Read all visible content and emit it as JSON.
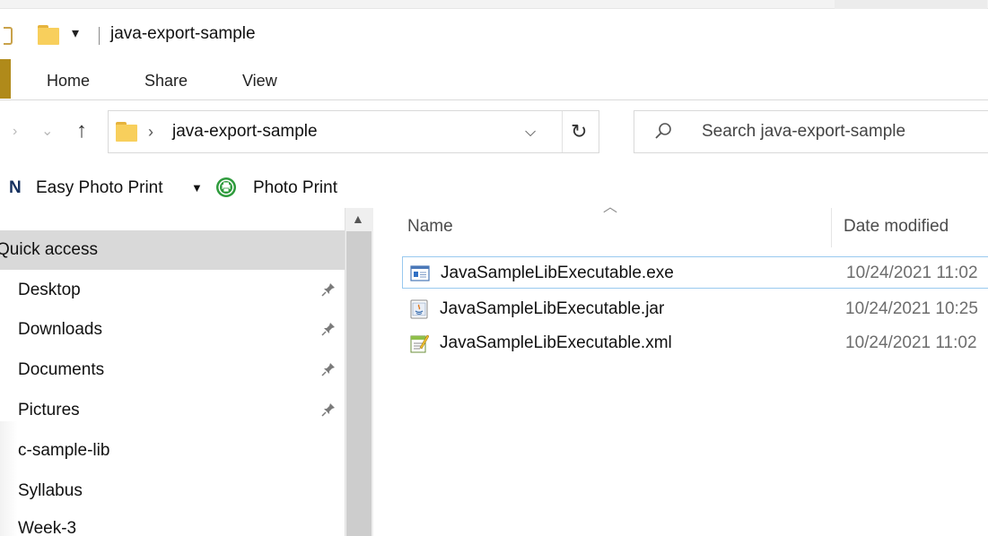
{
  "window": {
    "title": "java-export-sample",
    "qa_dropdown_glyph": "▾"
  },
  "ribbon": {
    "tabs": [
      "Home",
      "Share",
      "View"
    ]
  },
  "address": {
    "path_segment": "java-export-sample",
    "search_placeholder": "Search java-export-sample"
  },
  "toolbar": {
    "easy_photo_print": "Easy Photo Print",
    "photo_print": "Photo Print"
  },
  "nav": {
    "items": [
      {
        "label": "Quick access",
        "pinned": false,
        "selected": true
      },
      {
        "label": "Desktop",
        "pinned": true,
        "selected": false
      },
      {
        "label": "Downloads",
        "pinned": true,
        "selected": false
      },
      {
        "label": "Documents",
        "pinned": true,
        "selected": false
      },
      {
        "label": "Pictures",
        "pinned": true,
        "selected": false
      },
      {
        "label": "c-sample-lib",
        "pinned": false,
        "selected": false
      },
      {
        "label": "Syllabus",
        "pinned": false,
        "selected": false
      },
      {
        "label": "Week-3",
        "pinned": false,
        "selected": false
      }
    ]
  },
  "files": {
    "columns": {
      "name": "Name",
      "date": "Date modified"
    },
    "rows": [
      {
        "name": "JavaSampleLibExecutable.exe",
        "date": "10/24/2021 11:02",
        "icon": "exe-icon"
      },
      {
        "name": "JavaSampleLibExecutable.jar",
        "date": "10/24/2021 10:25",
        "icon": "jar-icon"
      },
      {
        "name": "JavaSampleLibExecutable.xml",
        "date": "10/24/2021 11:02",
        "icon": "xml-icon"
      }
    ]
  },
  "colors": {
    "accent_selection": "#d9d9d9",
    "focus_border": "#99c9ef",
    "folder": "#f8cf5c",
    "file_tab": "#b08a1a"
  }
}
